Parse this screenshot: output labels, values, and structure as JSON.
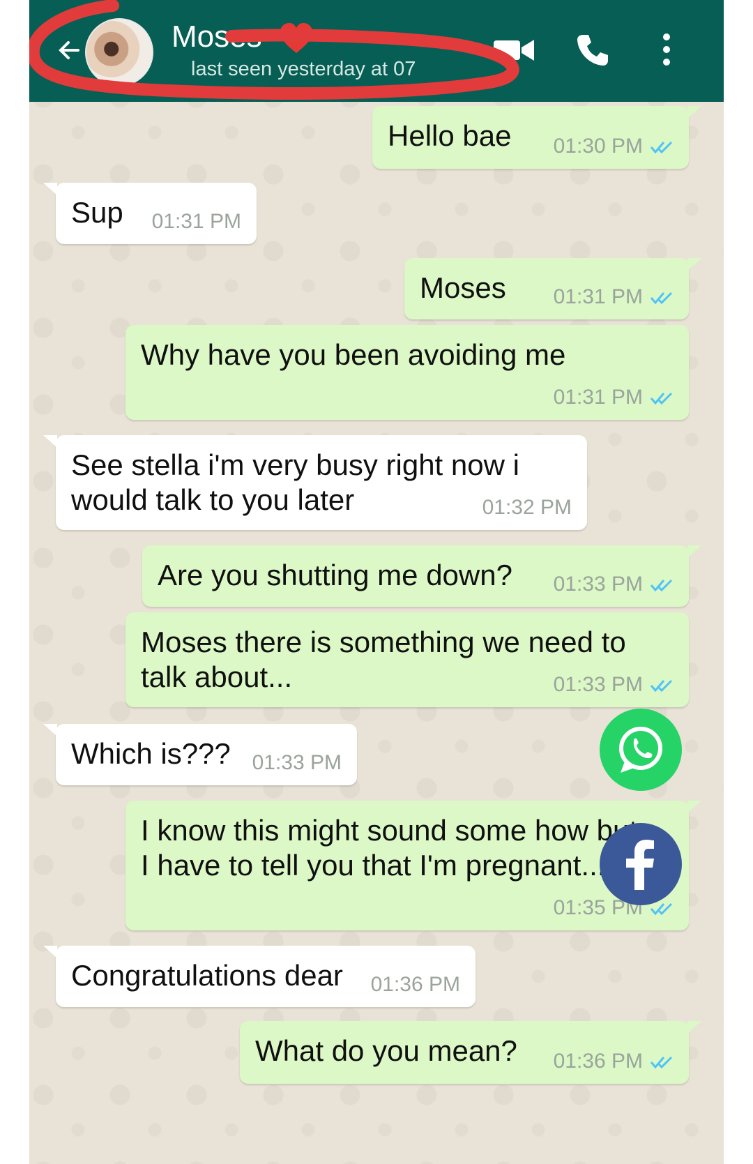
{
  "header": {
    "contact_name": "Moses",
    "status": "last seen yesterday at 07"
  },
  "colors": {
    "header_bg": "#075e54",
    "outgoing_bubble": "#dcf8c6",
    "incoming_bubble": "#ffffff",
    "read_ticks": "#4fc3f7",
    "annotation_red": "#e23b3b",
    "whatsapp_green": "#25d366",
    "facebook_blue": "#3b5998"
  },
  "messages": [
    {
      "direction": "out",
      "text": "Hello bae",
      "time": "01:30 PM",
      "status": "read"
    },
    {
      "direction": "in",
      "text": "Sup",
      "time": "01:31 PM"
    },
    {
      "direction": "out",
      "text": "Moses",
      "time": "01:31 PM",
      "status": "read"
    },
    {
      "direction": "out",
      "text": "Why have you been avoiding me",
      "time": "01:31 PM",
      "status": "read"
    },
    {
      "direction": "in",
      "text": "See stella i'm very busy right now i would talk to you later",
      "time": "01:32 PM"
    },
    {
      "direction": "out",
      "text": "Are you shutting me down?",
      "time": "01:33 PM",
      "status": "read"
    },
    {
      "direction": "out",
      "text": "Moses there is something we need to talk about...",
      "time": "01:33 PM",
      "status": "read"
    },
    {
      "direction": "in",
      "text": "Which is???",
      "time": "01:33 PM"
    },
    {
      "direction": "out",
      "text": "I know this might sound some how but I have to tell you that I'm pregnant...",
      "time": "01:35 PM",
      "status": "read"
    },
    {
      "direction": "in",
      "text": "Congratulations dear",
      "time": "01:36 PM"
    },
    {
      "direction": "out",
      "text": "What do you mean?",
      "time": "01:36 PM",
      "status": "read"
    }
  ],
  "icons": {
    "back": "back-arrow-icon",
    "avatar": "avatar",
    "heart": "heart-emoji-icon",
    "video": "video-call-icon",
    "call": "phone-call-icon",
    "menu": "more-options-icon",
    "share_whatsapp": "whatsapp-share-icon",
    "share_facebook": "facebook-share-icon"
  }
}
